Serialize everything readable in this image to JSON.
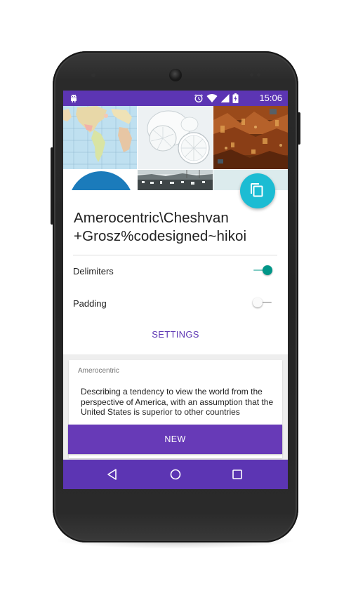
{
  "status_bar": {
    "time": "15:06",
    "background": "#5c35b3",
    "icons": [
      "android-icon",
      "alarm-icon",
      "wifi-icon",
      "signal-icon",
      "battery-charging-icon"
    ]
  },
  "header": {
    "title_line_1": "Amerocentric\\Cheshvan",
    "title_line_2": "+Grosz%codesigned~hikoi"
  },
  "copy_button": {
    "icon": "copy-icon",
    "color": "#1cbcd3"
  },
  "options": {
    "delimiters": {
      "label": "Delimiters",
      "enabled": true
    },
    "padding": {
      "label": "Padding",
      "enabled": false
    }
  },
  "settings_button": {
    "label": "SETTINGS"
  },
  "definition": {
    "word": "Amerocentric",
    "text": "Describing a tendency to view the world from the perspective of America, with an assumption that the United States is superior to other countries"
  },
  "new_button": {
    "label": "NEW"
  },
  "nav_bar": {
    "icons": [
      "back-icon",
      "home-icon",
      "recents-icon"
    ]
  },
  "colors": {
    "primary": "#5c35b3",
    "button": "#673ab7",
    "accent_teal": "#009688",
    "fab": "#1cbcd3"
  }
}
